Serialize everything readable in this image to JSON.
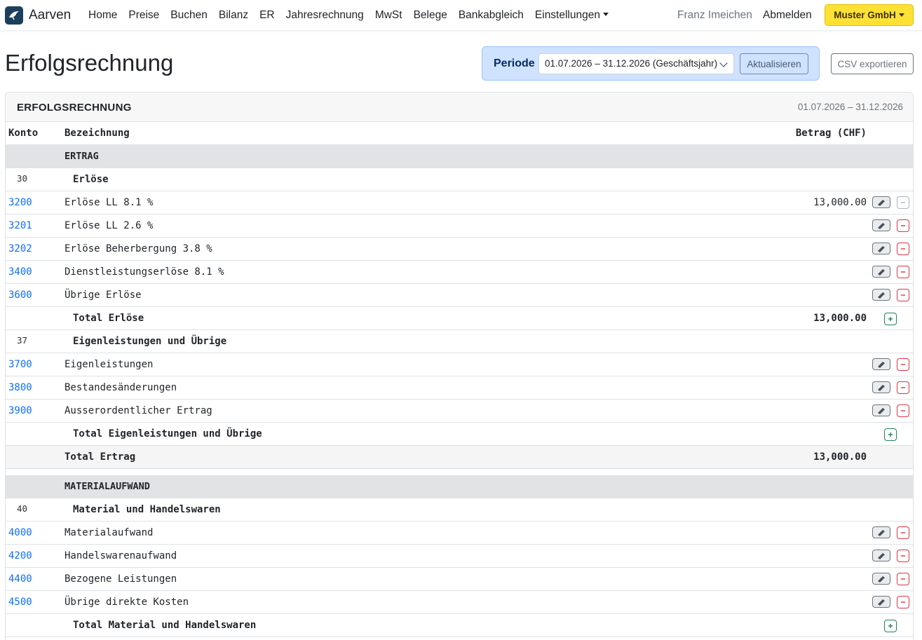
{
  "navbar": {
    "brand": "Aarven",
    "links": [
      "Home",
      "Preise",
      "Buchen",
      "Bilanz",
      "ER",
      "Jahresrechnung",
      "MwSt",
      "Belege",
      "Bankabgleich",
      "Einstellungen"
    ],
    "user": "Franz Imeichen",
    "logout": "Abmelden",
    "company": "Muster GmbH"
  },
  "header": {
    "title": "Erfolgsrechnung",
    "period_label": "Periode",
    "period_value": "01.07.2026 – 31.12.2026 (Geschäftsjahr)",
    "update_label": "Aktualisieren",
    "csv_label": "CSV exportieren"
  },
  "card": {
    "title": "ERFOLGSRECHNUNG",
    "range": "01.07.2026 – 31.12.2026",
    "columns": {
      "konto": "Konto",
      "bezeichnung": "Bezeichnung",
      "betrag": "Betrag (CHF)"
    }
  },
  "rows": [
    {
      "type": "section",
      "label": "ERTRAG"
    },
    {
      "type": "group",
      "num": "30",
      "label": "Erlöse"
    },
    {
      "type": "account",
      "konto": "3200",
      "label": "Erlöse LL 8.1 %",
      "betrag": "13,000.00",
      "remove_disabled": true
    },
    {
      "type": "account",
      "konto": "3201",
      "label": "Erlöse LL 2.6 %",
      "betrag": ""
    },
    {
      "type": "account",
      "konto": "3202",
      "label": "Erlöse Beherbergung 3.8 %",
      "betrag": ""
    },
    {
      "type": "account",
      "konto": "3400",
      "label": "Dienstleistungserlöse 8.1 %",
      "betrag": ""
    },
    {
      "type": "account",
      "konto": "3600",
      "label": "Übrige Erlöse",
      "betrag": ""
    },
    {
      "type": "subtotal",
      "label": "Total Erlöse",
      "betrag": "13,000.00"
    },
    {
      "type": "group",
      "num": "37",
      "label": "Eigenleistungen und Übrige"
    },
    {
      "type": "account",
      "konto": "3700",
      "label": "Eigenleistungen",
      "betrag": ""
    },
    {
      "type": "account",
      "konto": "3800",
      "label": "Bestandesänderungen",
      "betrag": ""
    },
    {
      "type": "account",
      "konto": "3900",
      "label": "Ausserordentlicher Ertrag",
      "betrag": ""
    },
    {
      "type": "subtotal",
      "label": "Total Eigenleistungen und Übrige",
      "betrag": ""
    },
    {
      "type": "total",
      "label": "Total Ertrag",
      "betrag": "13,000.00"
    },
    {
      "type": "gap"
    },
    {
      "type": "section",
      "label": "MATERIALAUFWAND"
    },
    {
      "type": "group",
      "num": "40",
      "label": "Material und Handelswaren"
    },
    {
      "type": "account",
      "konto": "4000",
      "label": "Materialaufwand",
      "betrag": ""
    },
    {
      "type": "account",
      "konto": "4200",
      "label": "Handelswarenaufwand",
      "betrag": ""
    },
    {
      "type": "account",
      "konto": "4400",
      "label": "Bezogene Leistungen",
      "betrag": ""
    },
    {
      "type": "account",
      "konto": "4500",
      "label": "Übrige direkte Kosten",
      "betrag": ""
    },
    {
      "type": "subtotal",
      "label": "Total Material und Handelswaren",
      "betrag": ""
    }
  ],
  "colors": {
    "accent": "#0d6efd",
    "company": "#ffe135",
    "danger": "#dc3545",
    "success": "#198754"
  },
  "icons": {
    "edit": "pencil-icon",
    "remove": "minus-icon",
    "add": "plus-icon",
    "brand": "bird-logo-icon"
  }
}
